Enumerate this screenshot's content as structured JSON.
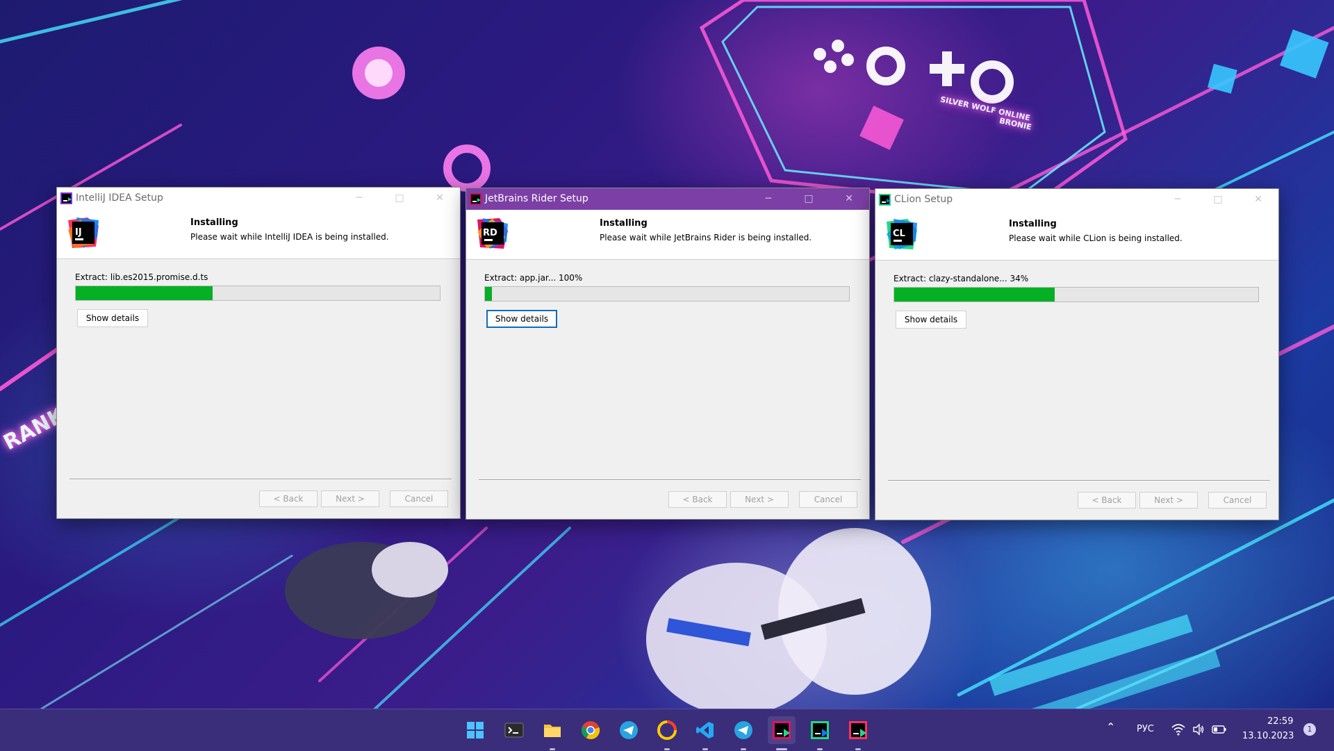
{
  "colors": {
    "progress_fill": "#06b025",
    "active_titlebar": "#7b3fa5",
    "focus_border": "#0f6cbd",
    "taskbar_bg": "#3a2d7a"
  },
  "wallpaper": {
    "logo_text_1": "SILVER WOLF ONLINE",
    "logo_text_2": "BRONIE",
    "side_text": "RANK"
  },
  "dialogs": [
    {
      "title": "IntelliJ IDEA Setup",
      "logo_letters": "IJ",
      "header_title": "Installing",
      "header_subtitle": "Please wait while IntelliJ IDEA is being installed.",
      "extract_text": "Extract: lib.es2015.promise.d.ts",
      "progress": 0.375,
      "show_details_label": "Show details",
      "back_label": "< Back",
      "next_label": "Next >",
      "cancel_label": "Cancel",
      "active": false,
      "details_focused": false
    },
    {
      "title": "JetBrains Rider Setup",
      "logo_letters": "RD",
      "header_title": "Installing",
      "header_subtitle": "Please wait while JetBrains Rider is being installed.",
      "extract_text": "Extract: app.jar... 100%",
      "progress": 0.02,
      "show_details_label": "Show details",
      "back_label": "< Back",
      "next_label": "Next >",
      "cancel_label": "Cancel",
      "active": true,
      "details_focused": true
    },
    {
      "title": "CLion Setup",
      "logo_letters": "CL",
      "header_title": "Installing",
      "header_subtitle": "Please wait while CLion is being installed.",
      "extract_text": "Extract: clazy-standalone... 34%",
      "progress": 0.44,
      "show_details_label": "Show details",
      "back_label": "< Back",
      "next_label": "Next >",
      "cancel_label": "Cancel",
      "active": false,
      "details_focused": false
    }
  ],
  "taskbar": {
    "apps": [
      {
        "name": "start-menu-icon"
      },
      {
        "name": "terminal-icon"
      },
      {
        "name": "file-explorer-icon"
      },
      {
        "name": "chrome-icon"
      },
      {
        "name": "telegram-icon"
      },
      {
        "name": "yandex-music-icon"
      },
      {
        "name": "vscode-icon"
      },
      {
        "name": "telegram-icon"
      },
      {
        "name": "rider-installer-icon"
      },
      {
        "name": "clion-installer-icon"
      },
      {
        "name": "intellij-installer-icon"
      }
    ],
    "language": "РУС",
    "time": "22:59",
    "date": "13.10.2023",
    "notification_count": "1"
  }
}
